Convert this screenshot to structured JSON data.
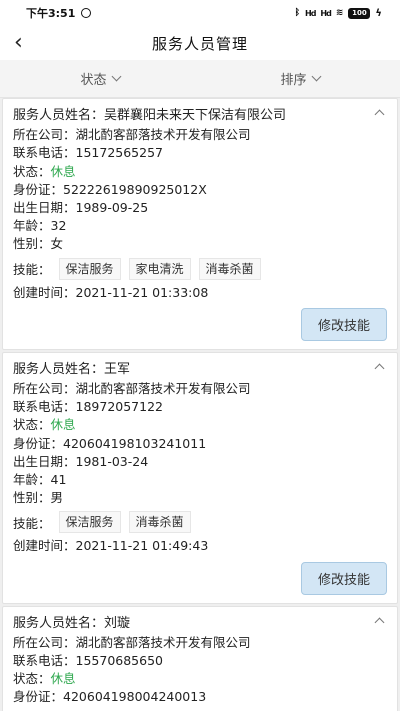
{
  "status_bar": {
    "time": "下午3:51",
    "signal1": "Hd",
    "signal2": "Hd",
    "battery": "100"
  },
  "header": {
    "title": "服务人员管理"
  },
  "filters": [
    {
      "label": "状态"
    },
    {
      "label": "排序"
    }
  ],
  "labels": {
    "name": "服务人员姓名：",
    "company": "所在公司：",
    "phone": "联系电话：",
    "status": "状态：",
    "id": "身份证：",
    "birth": "出生日期：",
    "age": "年龄：",
    "gender": "性别：",
    "skills": "技能：",
    "created": "创建时间：",
    "edit_button": "修改技能"
  },
  "workers": [
    {
      "name": "吴群襄阳未来天下保洁有限公司",
      "company": "湖北酌客部落技术开发有限公司",
      "phone": "15172565257",
      "status": "休息",
      "id": "52222619890925012X",
      "birth": "1989-09-25",
      "age": "32",
      "gender": "女",
      "skills": [
        "保洁服务",
        "家电清洗",
        "消毒杀菌"
      ],
      "created": "2021-11-21 01:33:08"
    },
    {
      "name": "王军",
      "company": "湖北酌客部落技术开发有限公司",
      "phone": "18972057122",
      "status": "休息",
      "id": "420604198103241011",
      "birth": "1981-03-24",
      "age": "41",
      "gender": "男",
      "skills": [
        "保洁服务",
        "消毒杀菌"
      ],
      "created": "2021-11-21 01:49:43"
    },
    {
      "name": "刘璇",
      "company": "湖北酌客部落技术开发有限公司",
      "phone": "15570685650",
      "status": "休息",
      "id": "420604198004240013"
    }
  ]
}
